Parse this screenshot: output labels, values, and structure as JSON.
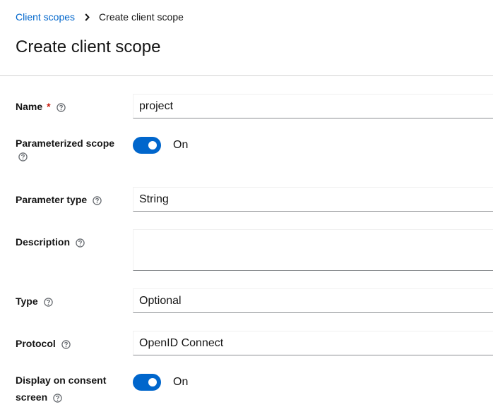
{
  "breadcrumb": {
    "parent": "Client scopes",
    "current": "Create client scope"
  },
  "page_title": "Create client scope",
  "form": {
    "name": {
      "label": "Name",
      "required_marker": "*",
      "value": "project"
    },
    "parameterized_scope": {
      "label": "Parameterized scope",
      "state": "On",
      "checked": true
    },
    "parameter_type": {
      "label": "Parameter type",
      "value": "String"
    },
    "description": {
      "label": "Description",
      "value": ""
    },
    "type": {
      "label": "Type",
      "value": "Optional"
    },
    "protocol": {
      "label": "Protocol",
      "value": "OpenID Connect"
    },
    "display_on_consent": {
      "label_line1": "Display on consent",
      "label_line2": "screen",
      "state": "On",
      "checked": true
    }
  },
  "colors": {
    "link": "#0066cc",
    "switch_on": "#0066cc",
    "required": "#c9190b",
    "help_icon": "#6a6e73"
  },
  "icons": {
    "separator": "chevron-right-icon",
    "help": "help-circle-icon"
  }
}
